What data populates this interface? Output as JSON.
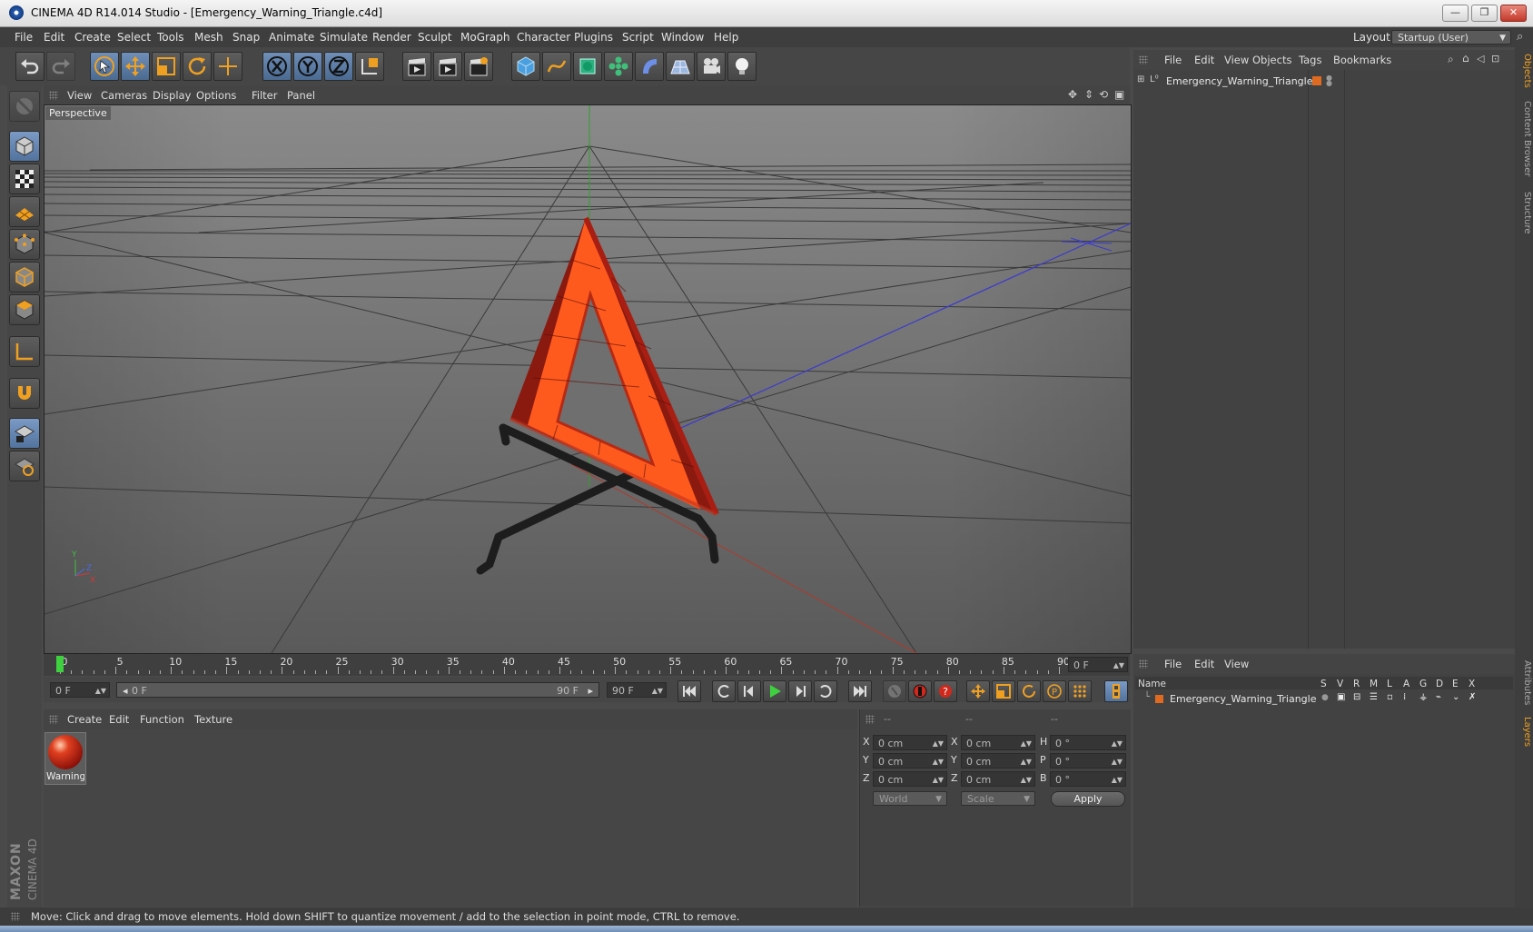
{
  "window": {
    "title": "CINEMA 4D R14.014 Studio - [Emergency_Warning_Triangle.c4d]",
    "minimize": "—",
    "restore": "❐",
    "close": "✕"
  },
  "menubar": {
    "items": [
      "File",
      "Edit",
      "Create",
      "Select",
      "Tools",
      "Mesh",
      "Snap",
      "Animate",
      "Simulate",
      "Render",
      "Sculpt",
      "MoGraph",
      "Character",
      "Plugins",
      "Script",
      "Window",
      "Help"
    ],
    "layout_label": "Layout:",
    "layout_value": "Startup (User)"
  },
  "viewport": {
    "menu": [
      "View",
      "Cameras",
      "Display",
      "Options",
      "Filter",
      "Panel"
    ],
    "camera_label": "Perspective",
    "axis_y": "Y",
    "axis_x": "X",
    "axis_z": "Z"
  },
  "timeline": {
    "ticks": [
      "0",
      "5",
      "10",
      "15",
      "20",
      "25",
      "30",
      "35",
      "40",
      "45",
      "50",
      "55",
      "60",
      "65",
      "70",
      "75",
      "80",
      "85",
      "90"
    ],
    "current_frame": "0 F",
    "start_field": "0 F",
    "range_start": "0 F",
    "range_end": "90 F",
    "end_field": "90 F"
  },
  "material_manager": {
    "menu": [
      "Create",
      "Edit",
      "Function",
      "Texture"
    ],
    "materials": [
      {
        "name": "Warning"
      }
    ]
  },
  "coordinates": {
    "headers": [
      "--",
      "--",
      "--"
    ],
    "rows": [
      {
        "a": "X",
        "av": "0 cm",
        "b": "X",
        "bv": "0 cm",
        "c": "H",
        "cv": "0 °"
      },
      {
        "a": "Y",
        "av": "0 cm",
        "b": "Y",
        "bv": "0 cm",
        "c": "P",
        "cv": "0 °"
      },
      {
        "a": "Z",
        "av": "0 cm",
        "b": "Z",
        "bv": "0 cm",
        "c": "B",
        "cv": "0 °"
      }
    ],
    "mode1": "World",
    "mode2": "Scale",
    "apply": "Apply"
  },
  "object_manager": {
    "menu": [
      "File",
      "Edit",
      "View",
      "Objects",
      "Tags",
      "Bookmarks"
    ],
    "objects": [
      {
        "name": "Emergency_Warning_Triangle"
      }
    ]
  },
  "layer_manager": {
    "menu": [
      "File",
      "Edit",
      "View"
    ],
    "columns": [
      "Name",
      "S",
      "V",
      "R",
      "M",
      "L",
      "A",
      "G",
      "D",
      "E",
      "X"
    ],
    "layers": [
      {
        "name": "Emergency_Warning_Triangle"
      }
    ]
  },
  "side_tabs": {
    "right_top": [
      "Objects",
      "Content Browser",
      "Structure"
    ],
    "right_bottom": [
      "Attributes",
      "Layers"
    ]
  },
  "brand": {
    "line1": "MAXON",
    "line2": "CINEMA 4D"
  },
  "status": "Move: Click and drag to move elements. Hold down SHIFT to quantize movement / add to the selection in point mode, CTRL to remove.",
  "colors": {
    "ui_background": "#4a4a4a",
    "accent_orange": "#f0a020",
    "triangle_orange": "#ff5a1e",
    "triangle_dark_red": "#8a1a10",
    "axis_blue": "#3a3ad0",
    "axis_green": "#2fa02f"
  }
}
